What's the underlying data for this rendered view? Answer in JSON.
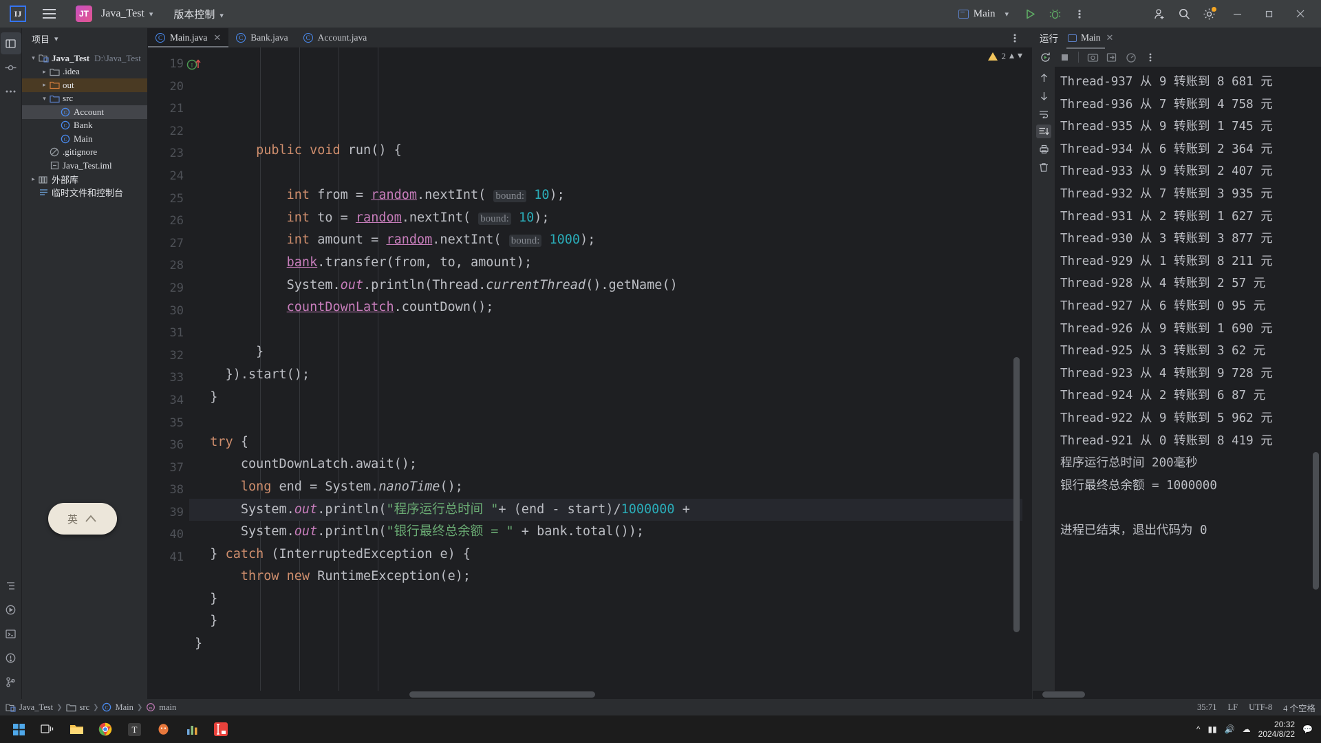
{
  "titlebar": {
    "logo": "IJ",
    "menu_icon": "hamburger-menu-icon",
    "project_badge": "JT",
    "project_name": "Java_Test",
    "vcs_label": "版本控制",
    "run_config": "Main",
    "icons": [
      "run-icon",
      "debug-icon",
      "more-options-icon",
      "add-user-icon",
      "search-icon",
      "settings-icon",
      "minimize-icon",
      "maximize-icon",
      "close-icon"
    ]
  },
  "leftrail": {
    "top_icons": [
      "project-icon",
      "commit-icon",
      "more-tool-windows-icon"
    ],
    "bottom_icons": [
      "structure-icon",
      "run-tool-icon",
      "terminal-icon",
      "problems-icon",
      "git-branch-icon"
    ]
  },
  "project_panel": {
    "header": "项目",
    "tree": [
      {
        "label": "Java_Test",
        "path": "D:\\Java_Test",
        "indent": 0,
        "twisty": "expanded",
        "icon": "module-icon",
        "bold": true,
        "state": ""
      },
      {
        "label": ".idea",
        "path": "",
        "indent": 1,
        "twisty": "collapsed",
        "icon": "folder-icon",
        "bold": false,
        "state": ""
      },
      {
        "label": "out",
        "path": "",
        "indent": 1,
        "twisty": "collapsed",
        "icon": "folder-excluded-icon",
        "bold": false,
        "state": "sel-orange"
      },
      {
        "label": "src",
        "path": "",
        "indent": 1,
        "twisty": "expanded",
        "icon": "folder-source-icon",
        "bold": false,
        "state": ""
      },
      {
        "label": "Account",
        "path": "",
        "indent": 2,
        "twisty": "none",
        "icon": "java-class-icon",
        "bold": false,
        "state": "sel-gray"
      },
      {
        "label": "Bank",
        "path": "",
        "indent": 2,
        "twisty": "none",
        "icon": "java-class-icon",
        "bold": false,
        "state": ""
      },
      {
        "label": "Main",
        "path": "",
        "indent": 2,
        "twisty": "none",
        "icon": "java-class-icon",
        "bold": false,
        "state": ""
      },
      {
        "label": ".gitignore",
        "path": "",
        "indent": 1,
        "twisty": "none",
        "icon": "gitignore-icon",
        "bold": false,
        "state": ""
      },
      {
        "label": "Java_Test.iml",
        "path": "",
        "indent": 1,
        "twisty": "none",
        "icon": "iml-file-icon",
        "bold": false,
        "state": ""
      },
      {
        "label": "外部库",
        "path": "",
        "indent": 0,
        "twisty": "collapsed",
        "icon": "library-icon",
        "bold": false,
        "state": ""
      },
      {
        "label": "临时文件和控制台",
        "path": "",
        "indent": 0,
        "twisty": "none",
        "icon": "scratches-icon",
        "bold": false,
        "state": ""
      }
    ]
  },
  "editor": {
    "tabs": [
      {
        "label": "Main.java",
        "active": true,
        "closable": true
      },
      {
        "label": "Bank.java",
        "active": false,
        "closable": false
      },
      {
        "label": "Account.java",
        "active": false,
        "closable": false
      }
    ],
    "tab_options_icon": "editor-options-icon",
    "inspection": {
      "warning_count": "2",
      "error_count": "",
      "up_icon": "previous-highlight-icon",
      "down_icon": "next-highlight-icon"
    },
    "first_line_number": 19,
    "current_line": 35,
    "lines": [
      {
        "n": 19,
        "marker": "implements-method-icon",
        "html": "        <span class=\"kw\">public</span> <span class=\"kw\">void</span> <span class=\"plain\">run() {</span>"
      },
      {
        "n": 20,
        "marker": "",
        "html": ""
      },
      {
        "n": 21,
        "marker": "",
        "html": "            <span class=\"kw\">int</span> <span class=\"plain\">from = </span><span class=\"fld\">random</span><span class=\"plain\">.nextInt(</span> <span class=\"hint\">bound:</span> <span class=\"num\">10</span><span class=\"plain\">);</span>"
      },
      {
        "n": 22,
        "marker": "",
        "html": "            <span class=\"kw\">int</span> <span class=\"plain\">to = </span><span class=\"fld\">random</span><span class=\"plain\">.nextInt(</span> <span class=\"hint\">bound:</span> <span class=\"num\">10</span><span class=\"plain\">);</span>"
      },
      {
        "n": 23,
        "marker": "",
        "html": "            <span class=\"kw\">int</span> <span class=\"plain\">amount = </span><span class=\"fld\">random</span><span class=\"plain\">.nextInt(</span> <span class=\"hint\">bound:</span> <span class=\"num\">1000</span><span class=\"plain\">);</span>"
      },
      {
        "n": 24,
        "marker": "",
        "html": "            <span class=\"fld\">bank</span><span class=\"plain\">.transfer(from, to, amount);</span>"
      },
      {
        "n": 25,
        "marker": "",
        "html": "            <span class=\"plain\">System.</span><span class=\"fldp\">out</span><span class=\"plain\">.println(Thread.</span><span class=\"ital\">currentThread</span><span class=\"plain\">().getName()</span>"
      },
      {
        "n": 26,
        "marker": "",
        "html": "            <span class=\"fld\">countDownLatch</span><span class=\"plain\">.countDown();</span>"
      },
      {
        "n": 27,
        "marker": "",
        "html": ""
      },
      {
        "n": 28,
        "marker": "",
        "html": "        <span class=\"plain\">}</span>"
      },
      {
        "n": 29,
        "marker": "",
        "html": "    <span class=\"plain\">}).start();</span>"
      },
      {
        "n": 30,
        "marker": "",
        "html": "  <span class=\"plain\">}</span>"
      },
      {
        "n": 31,
        "marker": "",
        "html": ""
      },
      {
        "n": 32,
        "marker": "",
        "html": "  <span class=\"kw\">try</span> <span class=\"plain\">{</span>"
      },
      {
        "n": 33,
        "marker": "",
        "html": "      <span class=\"plain\">countDownLatch.await();</span>"
      },
      {
        "n": 34,
        "marker": "",
        "html": "      <span class=\"kw\">long</span> <span class=\"plain\">end = System.</span><span class=\"ital\">nanoTime</span><span class=\"plain\">();</span>"
      },
      {
        "n": 35,
        "marker": "",
        "html": "      <span class=\"plain\">System.</span><span class=\"fldp\">out</span><span class=\"plain\">.println(</span><span class=\"str\">\"程序运行总时间 \"</span><span class=\"plain\">+ (end - start)/</span><span class=\"num\">1000000</span><span class=\"plain\"> +</span>"
      },
      {
        "n": 36,
        "marker": "",
        "html": "      <span class=\"plain\">System.</span><span class=\"fldp\">out</span><span class=\"plain\">.println(</span><span class=\"str\">\"银行最终总余额 = \"</span><span class=\"plain\"> + bank.total());</span>"
      },
      {
        "n": 37,
        "marker": "",
        "html": "  <span class=\"plain\">} </span><span class=\"kw\">catch</span> <span class=\"plain\">(InterruptedException e) {</span>"
      },
      {
        "n": 38,
        "marker": "",
        "html": "      <span class=\"kw\">throw new</span> <span class=\"plain\">RuntimeException(e);</span>"
      },
      {
        "n": 39,
        "marker": "",
        "html": "  <span class=\"plain\">}</span>"
      },
      {
        "n": 40,
        "marker": "",
        "html": "  <span class=\"plain\">}</span>"
      },
      {
        "n": 41,
        "marker": "",
        "html": "<span class=\"plain\">}</span>"
      }
    ]
  },
  "run_panel": {
    "title": "运行",
    "tab_label": "Main",
    "tab_close_icon": "close-icon",
    "toolbar_icons": [
      "rerun-icon",
      "stop-icon",
      "screenshot-icon",
      "export-icon",
      "profile-icon",
      "more-options-icon"
    ],
    "gutter_icons": [
      "scroll-up-icon",
      "scroll-down-icon",
      "soft-wrap-icon",
      "scroll-to-end-icon",
      "print-icon",
      "trash-icon"
    ],
    "console_lines": [
      "Thread-937 从 9 转账到 8 681 元",
      "Thread-936 从 7 转账到 4 758 元",
      "Thread-935 从 9 转账到 1 745 元",
      "Thread-934 从 6 转账到 2 364 元",
      "Thread-933 从 9 转账到 2 407 元",
      "Thread-932 从 7 转账到 3 935 元",
      "Thread-931 从 2 转账到 1 627 元",
      "Thread-930 从 3 转账到 3 877 元",
      "Thread-929 从 1 转账到 8 211 元",
      "Thread-928 从 4 转账到 2 57 元",
      "Thread-927 从 6 转账到 0 95 元",
      "Thread-926 从 9 转账到 1 690 元",
      "Thread-925 从 3 转账到 3 62 元",
      "Thread-923 从 4 转账到 9 728 元",
      "Thread-924 从 2 转账到 6 87 元",
      "Thread-922 从 9 转账到 5 962 元",
      "Thread-921 从 0 转账到 8 419 元",
      "程序运行总时间 200毫秒",
      "银行最终总余额 = 1000000",
      "",
      "进程已结束，退出代码为 0"
    ]
  },
  "statusbar": {
    "breadcrumbs": [
      {
        "label": "Java_Test",
        "icon": "module-icon"
      },
      {
        "label": "src",
        "icon": "folder-icon"
      },
      {
        "label": "Main",
        "icon": "java-class-icon"
      },
      {
        "label": "main",
        "icon": "method-icon"
      }
    ],
    "caret": "35:71",
    "line_separator": "LF",
    "encoding": "UTF-8",
    "indent": "4 个空格"
  },
  "taskbar": {
    "icons": [
      "windows-start-icon",
      "task-view-icon",
      "file-explorer-icon",
      "chrome-icon",
      "typora-icon",
      "qq-icon",
      "wechat-icon",
      "idea-icon"
    ],
    "tray_icons": [
      "show-hidden-icon",
      "input-method-icon",
      "volume-icon",
      "network-icon",
      "notification-icon"
    ],
    "clock_time": "20:32",
    "clock_date": "2024/8/22"
  },
  "ime_popup": {
    "label": "英",
    "icon": "ime-toggle-icon"
  },
  "colors": {
    "accent_blue": "#3574f0",
    "warning": "#f2c55c",
    "run_green": "#5fad65",
    "string_green": "#6aab73",
    "number_cyan": "#2aacb8",
    "keyword_orange": "#cf8e6d",
    "field_purple": "#c77dbb"
  }
}
